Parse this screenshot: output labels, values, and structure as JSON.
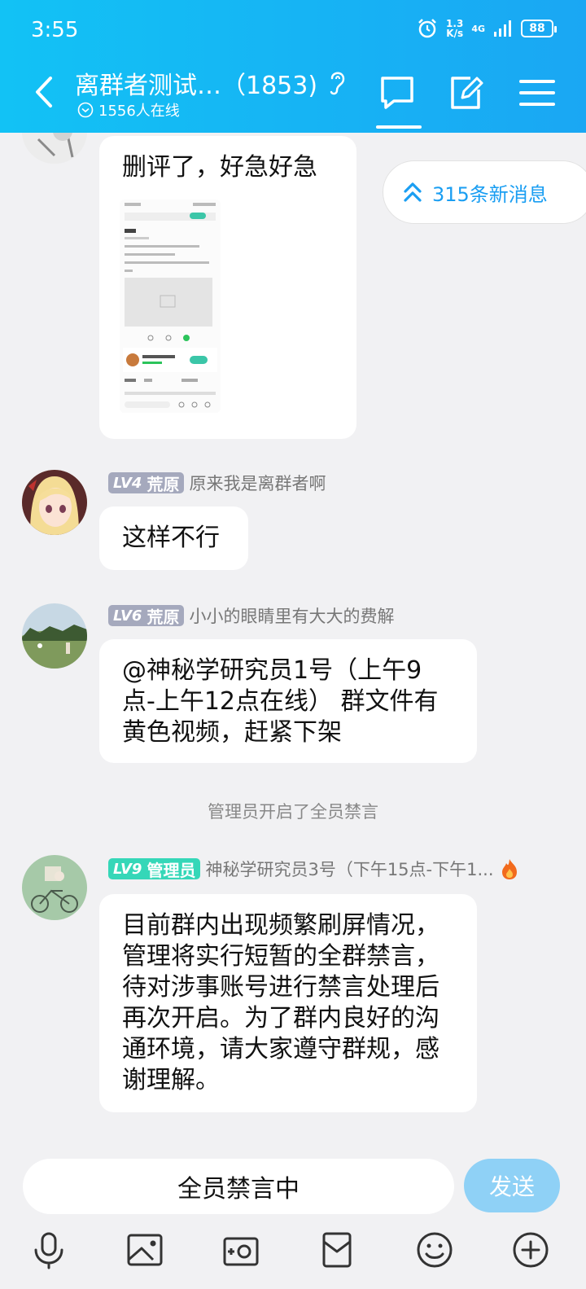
{
  "status_bar": {
    "time": "3:55",
    "speed_value": "1.3",
    "speed_unit": "K/s",
    "network": "4G",
    "battery": "88"
  },
  "header": {
    "title": "离群者测试…（1853)",
    "online_text": "1556人在线"
  },
  "new_messages": "315条新消息",
  "messages": [
    {
      "text": "删评了，好急好急"
    },
    {
      "level": "LV4",
      "role": "荒原",
      "nickname": "原来我是离群者啊",
      "text": "这样不行"
    },
    {
      "level": "LV6",
      "role": "荒原",
      "nickname": "小小的眼睛里有大大的费解",
      "text": "@神秘学研究员1号（上午9点-上午12点在线） 群文件有黄色视频，赶紧下架"
    },
    {
      "level": "LV9",
      "role": "管理员",
      "nickname": "神秘学研究员3号（下午15点-下午1...",
      "text": "目前群内出现频繁刷屏情况，管理将实行短暂的全群禁言，待对涉事账号进行禁言处理后再次开启。为了群内良好的沟通环境，请大家遵守群规，感谢理解。"
    }
  ],
  "system_notice": "管理员开启了全员禁言",
  "input": {
    "muted_text": "全员禁言中",
    "send_label": "发送"
  },
  "thumbnail": {
    "title": "如图",
    "card_name": "星砺未来：1999"
  },
  "colors": {
    "header_gradient_start": "#12c2f5",
    "header_gradient_end": "#1aa7f3",
    "accent_blue": "#1a9ef2",
    "level_gray": "#a5a9bd",
    "level_teal": "#35d7b8",
    "send_button": "#8fd1f6"
  },
  "toolbar_icons": [
    "microphone-icon",
    "image-icon",
    "camera-icon",
    "red-packet-icon",
    "emoji-icon",
    "plus-icon"
  ]
}
